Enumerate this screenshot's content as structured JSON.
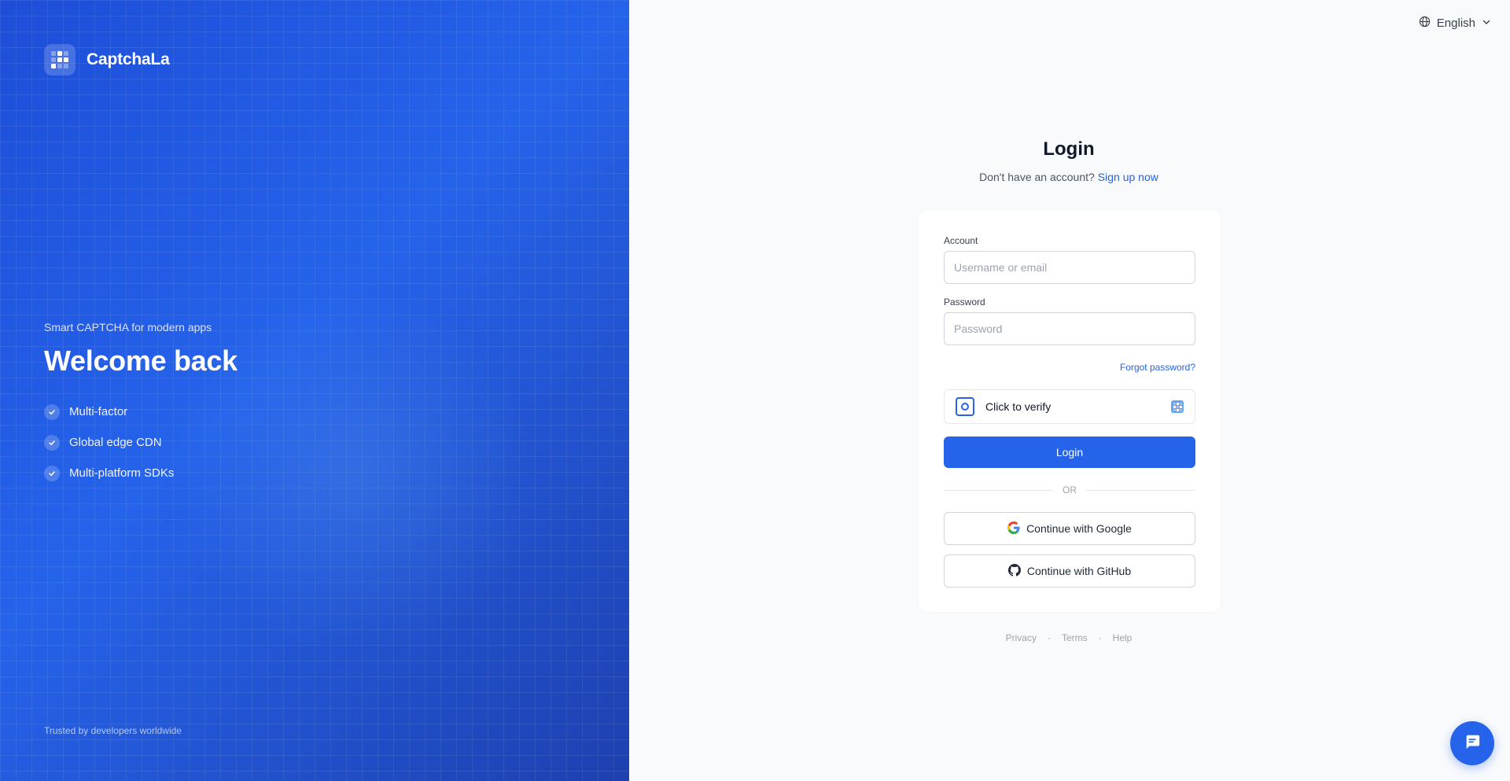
{
  "brand": {
    "name": "CaptchaLa",
    "logo_icon": "grid-logo-icon"
  },
  "hero": {
    "tagline": "Smart CAPTCHA for modern apps",
    "headline": "Welcome back",
    "features": [
      "Multi-factor",
      "Global edge CDN",
      "Multi-platform SDKs"
    ],
    "trusted": "Trusted by developers worldwide",
    "gradient_colors": [
      "#1d4ed8",
      "#2563eb",
      "#1e40af"
    ]
  },
  "language": {
    "selected": "English",
    "icon": "globe-icon"
  },
  "login": {
    "title": "Login",
    "signup_prompt": "Don't have an account?",
    "signup_link": "Sign up now",
    "account_label": "Account",
    "account_placeholder": "Username or email",
    "password_label": "Password",
    "password_placeholder": "Password",
    "forgot": "Forgot password?",
    "verify_label": "Click to verify",
    "submit": "Login",
    "divider": "OR",
    "google": "Continue with Google",
    "github": "Continue with GitHub"
  },
  "footer": {
    "links": [
      "Privacy",
      "Terms",
      "Help"
    ],
    "separator": "·"
  },
  "chat": {
    "icon": "chat-bubble-icon"
  },
  "colors": {
    "accent": "#2563eb",
    "page_bg": "#f8fafc"
  }
}
